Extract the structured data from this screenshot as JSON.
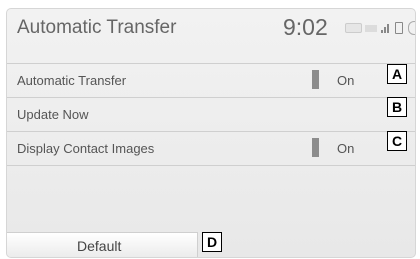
{
  "header": {
    "title": "Automatic Transfer",
    "time": "9:02",
    "status_icons": [
      "bluetooth-indicator",
      "signal-icon",
      "battery-icon"
    ]
  },
  "settings": {
    "rows": [
      {
        "label": "Automatic Transfer",
        "toggle": "On",
        "callout": "A"
      },
      {
        "label": "Update Now",
        "callout": "B"
      },
      {
        "label": "Display Contact Images",
        "toggle": "On",
        "callout": "C"
      }
    ]
  },
  "footer": {
    "default_label": "Default",
    "callout": "D"
  }
}
